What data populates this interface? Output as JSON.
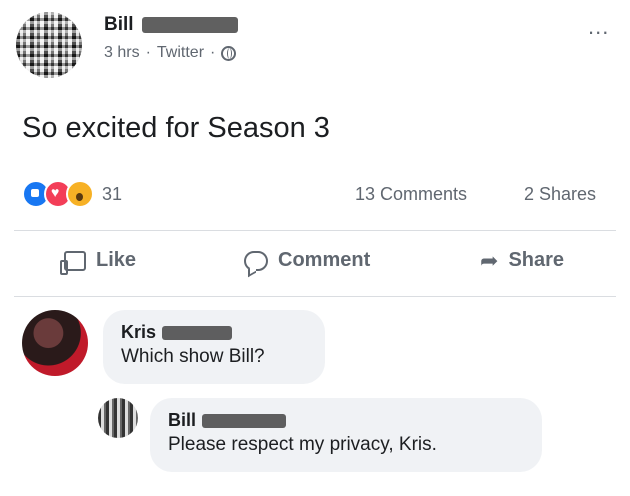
{
  "post": {
    "author": "Bill",
    "time": "3 hrs",
    "source": "Twitter",
    "separator1": "·",
    "separator2": "·",
    "more_menu": "...",
    "text": "So excited for Season 3",
    "reaction_count": "31",
    "comments_count": "13 Comments",
    "shares_count": "2 Shares",
    "reaction_icons": [
      "like-icon",
      "love-icon",
      "wow-icon"
    ]
  },
  "actions": {
    "like": "Like",
    "comment": "Comment",
    "share": "Share"
  },
  "comments": [
    {
      "author": "Kris",
      "text": "Which show Bill?"
    },
    {
      "author": "Bill",
      "text": "Please respect my privacy, Kris."
    }
  ]
}
